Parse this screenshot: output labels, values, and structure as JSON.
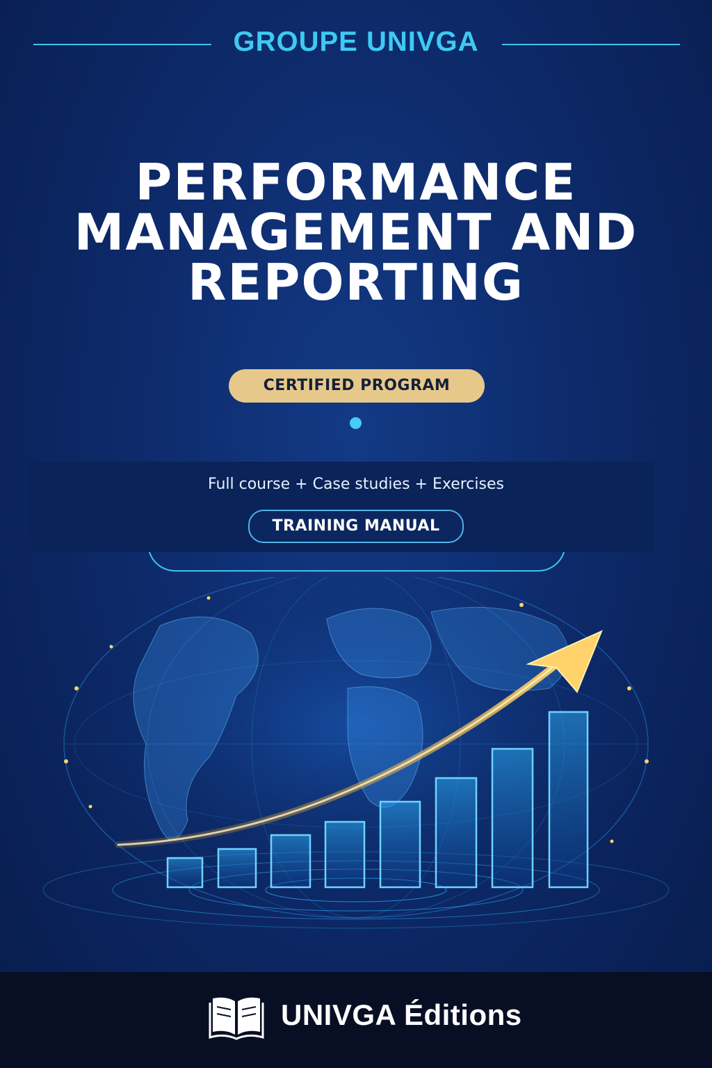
{
  "publisher": {
    "name": "GROUPE UNIVGA"
  },
  "title": {
    "lines": [
      "PERFORMANCE",
      "MANAGEMENT AND",
      "REPORTING"
    ]
  },
  "badges": {
    "certified": "CERTIFIED PROGRAM",
    "manual": "TRAINING MANUAL"
  },
  "subtitle": "Full course + Case studies + Exercises",
  "footer": {
    "brand": "UNIVGA Éditions",
    "logo_icon": "open-book-icon"
  },
  "illustration": {
    "icons": [
      "globe-icon",
      "bar-chart-icon",
      "growth-arrow-icon"
    ]
  },
  "colors": {
    "accent": "#3fc9f2",
    "gold": "#e6c98a",
    "background": "#0d2a6a",
    "footer": "#080f24"
  }
}
